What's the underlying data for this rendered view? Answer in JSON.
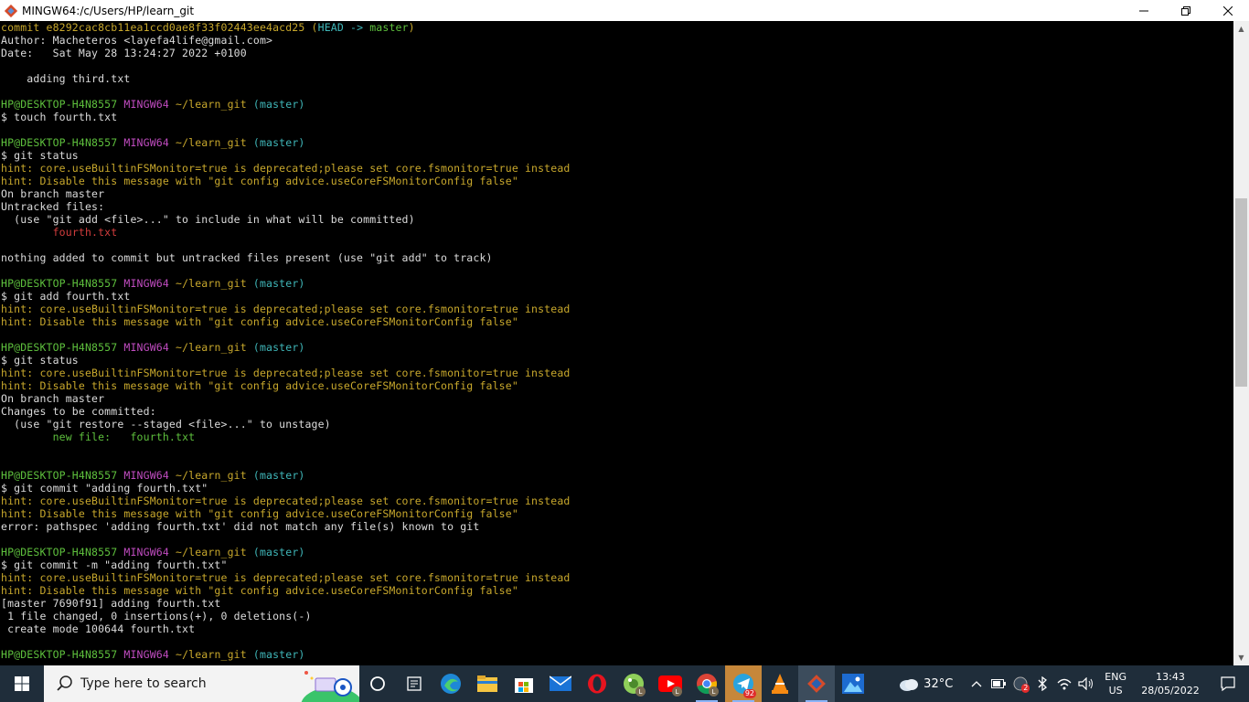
{
  "window": {
    "title": "MINGW64:/c/Users/HP/learn_git",
    "controls": {
      "minimize": "—",
      "maximize": "❐",
      "close": "✕"
    }
  },
  "terminal": {
    "lines": [
      [
        {
          "t": "commit e8292cac8cb11ea1ccd0ae8f33f02443ee4acd25 ",
          "c": "yellow"
        },
        {
          "t": "(",
          "c": "yellow"
        },
        {
          "t": "HEAD -> ",
          "c": "cyan"
        },
        {
          "t": "master",
          "c": "green"
        },
        {
          "t": ")",
          "c": "yellow"
        }
      ],
      [
        {
          "t": "Author: Macheteros <layefa4life@gmail.com>",
          "c": "white"
        }
      ],
      [
        {
          "t": "Date:   Sat May 28 13:24:27 2022 +0100",
          "c": "white"
        }
      ],
      [
        {
          "t": "",
          "c": "white"
        }
      ],
      [
        {
          "t": "    adding third.txt",
          "c": "white"
        }
      ],
      [
        {
          "t": "",
          "c": "white"
        }
      ],
      [
        {
          "t": "HP@DESKTOP-H4N8557 ",
          "c": "green"
        },
        {
          "t": "MINGW64 ",
          "c": "magenta"
        },
        {
          "t": "~/learn_git ",
          "c": "yellow"
        },
        {
          "t": "(master)",
          "c": "cyan"
        }
      ],
      [
        {
          "t": "$ touch fourth.txt",
          "c": "white"
        }
      ],
      [
        {
          "t": "",
          "c": "white"
        }
      ],
      [
        {
          "t": "HP@DESKTOP-H4N8557 ",
          "c": "green"
        },
        {
          "t": "MINGW64 ",
          "c": "magenta"
        },
        {
          "t": "~/learn_git ",
          "c": "yellow"
        },
        {
          "t": "(master)",
          "c": "cyan"
        }
      ],
      [
        {
          "t": "$ git status",
          "c": "white"
        }
      ],
      [
        {
          "t": "hint: core.useBuiltinFSMonitor=true is deprecated;please set core.fsmonitor=true instead",
          "c": "hint"
        }
      ],
      [
        {
          "t": "hint: Disable this message with \"git config advice.useCoreFSMonitorConfig false\"",
          "c": "hint"
        }
      ],
      [
        {
          "t": "On branch master",
          "c": "white"
        }
      ],
      [
        {
          "t": "Untracked files:",
          "c": "white"
        }
      ],
      [
        {
          "t": "  (use \"git add <file>...\" to include in what will be committed)",
          "c": "white"
        }
      ],
      [
        {
          "t": "        ",
          "c": "white"
        },
        {
          "t": "fourth.txt",
          "c": "red"
        }
      ],
      [
        {
          "t": "",
          "c": "white"
        }
      ],
      [
        {
          "t": "nothing added to commit but untracked files present (use \"git add\" to track)",
          "c": "white"
        }
      ],
      [
        {
          "t": "",
          "c": "white"
        }
      ],
      [
        {
          "t": "HP@DESKTOP-H4N8557 ",
          "c": "green"
        },
        {
          "t": "MINGW64 ",
          "c": "magenta"
        },
        {
          "t": "~/learn_git ",
          "c": "yellow"
        },
        {
          "t": "(master)",
          "c": "cyan"
        }
      ],
      [
        {
          "t": "$ git add fourth.txt",
          "c": "white"
        }
      ],
      [
        {
          "t": "hint: core.useBuiltinFSMonitor=true is deprecated;please set core.fsmonitor=true instead",
          "c": "hint"
        }
      ],
      [
        {
          "t": "hint: Disable this message with \"git config advice.useCoreFSMonitorConfig false\"",
          "c": "hint"
        }
      ],
      [
        {
          "t": "",
          "c": "white"
        }
      ],
      [
        {
          "t": "HP@DESKTOP-H4N8557 ",
          "c": "green"
        },
        {
          "t": "MINGW64 ",
          "c": "magenta"
        },
        {
          "t": "~/learn_git ",
          "c": "yellow"
        },
        {
          "t": "(master)",
          "c": "cyan"
        }
      ],
      [
        {
          "t": "$ git status",
          "c": "white"
        }
      ],
      [
        {
          "t": "hint: core.useBuiltinFSMonitor=true is deprecated;please set core.fsmonitor=true instead",
          "c": "hint"
        }
      ],
      [
        {
          "t": "hint: Disable this message with \"git config advice.useCoreFSMonitorConfig false\"",
          "c": "hint"
        }
      ],
      [
        {
          "t": "On branch master",
          "c": "white"
        }
      ],
      [
        {
          "t": "Changes to be committed:",
          "c": "white"
        }
      ],
      [
        {
          "t": "  (use \"git restore --staged <file>...\" to unstage)",
          "c": "white"
        }
      ],
      [
        {
          "t": "        ",
          "c": "white"
        },
        {
          "t": "new file:   fourth.txt",
          "c": "green"
        }
      ],
      [
        {
          "t": "",
          "c": "white"
        }
      ],
      [
        {
          "t": "",
          "c": "white"
        }
      ],
      [
        {
          "t": "HP@DESKTOP-H4N8557 ",
          "c": "green"
        },
        {
          "t": "MINGW64 ",
          "c": "magenta"
        },
        {
          "t": "~/learn_git ",
          "c": "yellow"
        },
        {
          "t": "(master)",
          "c": "cyan"
        }
      ],
      [
        {
          "t": "$ git commit \"adding fourth.txt\"",
          "c": "white"
        }
      ],
      [
        {
          "t": "hint: core.useBuiltinFSMonitor=true is deprecated;please set core.fsmonitor=true instead",
          "c": "hint"
        }
      ],
      [
        {
          "t": "hint: Disable this message with \"git config advice.useCoreFSMonitorConfig false\"",
          "c": "hint"
        }
      ],
      [
        {
          "t": "error: pathspec 'adding fourth.txt' did not match any file(s) known to git",
          "c": "white"
        }
      ],
      [
        {
          "t": "",
          "c": "white"
        }
      ],
      [
        {
          "t": "HP@DESKTOP-H4N8557 ",
          "c": "green"
        },
        {
          "t": "MINGW64 ",
          "c": "magenta"
        },
        {
          "t": "~/learn_git ",
          "c": "yellow"
        },
        {
          "t": "(master)",
          "c": "cyan"
        }
      ],
      [
        {
          "t": "$ git commit -m \"adding fourth.txt\"",
          "c": "white"
        }
      ],
      [
        {
          "t": "hint: core.useBuiltinFSMonitor=true is deprecated;please set core.fsmonitor=true instead",
          "c": "hint"
        }
      ],
      [
        {
          "t": "hint: Disable this message with \"git config advice.useCoreFSMonitorConfig false\"",
          "c": "hint"
        }
      ],
      [
        {
          "t": "[master 7690f91] adding fourth.txt",
          "c": "white"
        }
      ],
      [
        {
          "t": " 1 file changed, 0 insertions(+), 0 deletions(-)",
          "c": "white"
        }
      ],
      [
        {
          "t": " create mode 100644 fourth.txt",
          "c": "white"
        }
      ],
      [
        {
          "t": "",
          "c": "white"
        }
      ],
      [
        {
          "t": "HP@DESKTOP-H4N8557 ",
          "c": "green"
        },
        {
          "t": "MINGW64 ",
          "c": "magenta"
        },
        {
          "t": "~/learn_git ",
          "c": "yellow"
        },
        {
          "t": "(master)",
          "c": "cyan"
        }
      ]
    ]
  },
  "scrollbar": {
    "up": "▲",
    "down": "▼"
  },
  "taskbar": {
    "search_placeholder": "Type here to search",
    "apps": [
      {
        "name": "task-view-icon"
      },
      {
        "name": "widgets-icon"
      },
      {
        "name": "edge-icon"
      },
      {
        "name": "file-explorer-icon"
      },
      {
        "name": "microsoft-store-icon"
      },
      {
        "name": "mail-icon"
      },
      {
        "name": "opera-icon"
      },
      {
        "name": "chrome-profile-icon",
        "badge": "L"
      },
      {
        "name": "youtube-icon",
        "badge": "L"
      },
      {
        "name": "chrome-icon",
        "badge": "L"
      },
      {
        "name": "telegram-icon",
        "count": "92"
      },
      {
        "name": "vlc-icon"
      },
      {
        "name": "git-bash-icon"
      },
      {
        "name": "photos-icon"
      }
    ],
    "weather": {
      "temp": "32°C"
    },
    "tray": {
      "lang_top": "ENG",
      "lang_bottom": "US",
      "time": "13:43",
      "date": "28/05/2022",
      "wifi_badge": "2"
    }
  },
  "colors": {
    "green": "#5ec03d",
    "magenta": "#c04cc0",
    "yellow": "#c8a82c",
    "cyan": "#3fb6b8",
    "red": "#d43d3d",
    "taskbar": "#1f2d3a"
  }
}
